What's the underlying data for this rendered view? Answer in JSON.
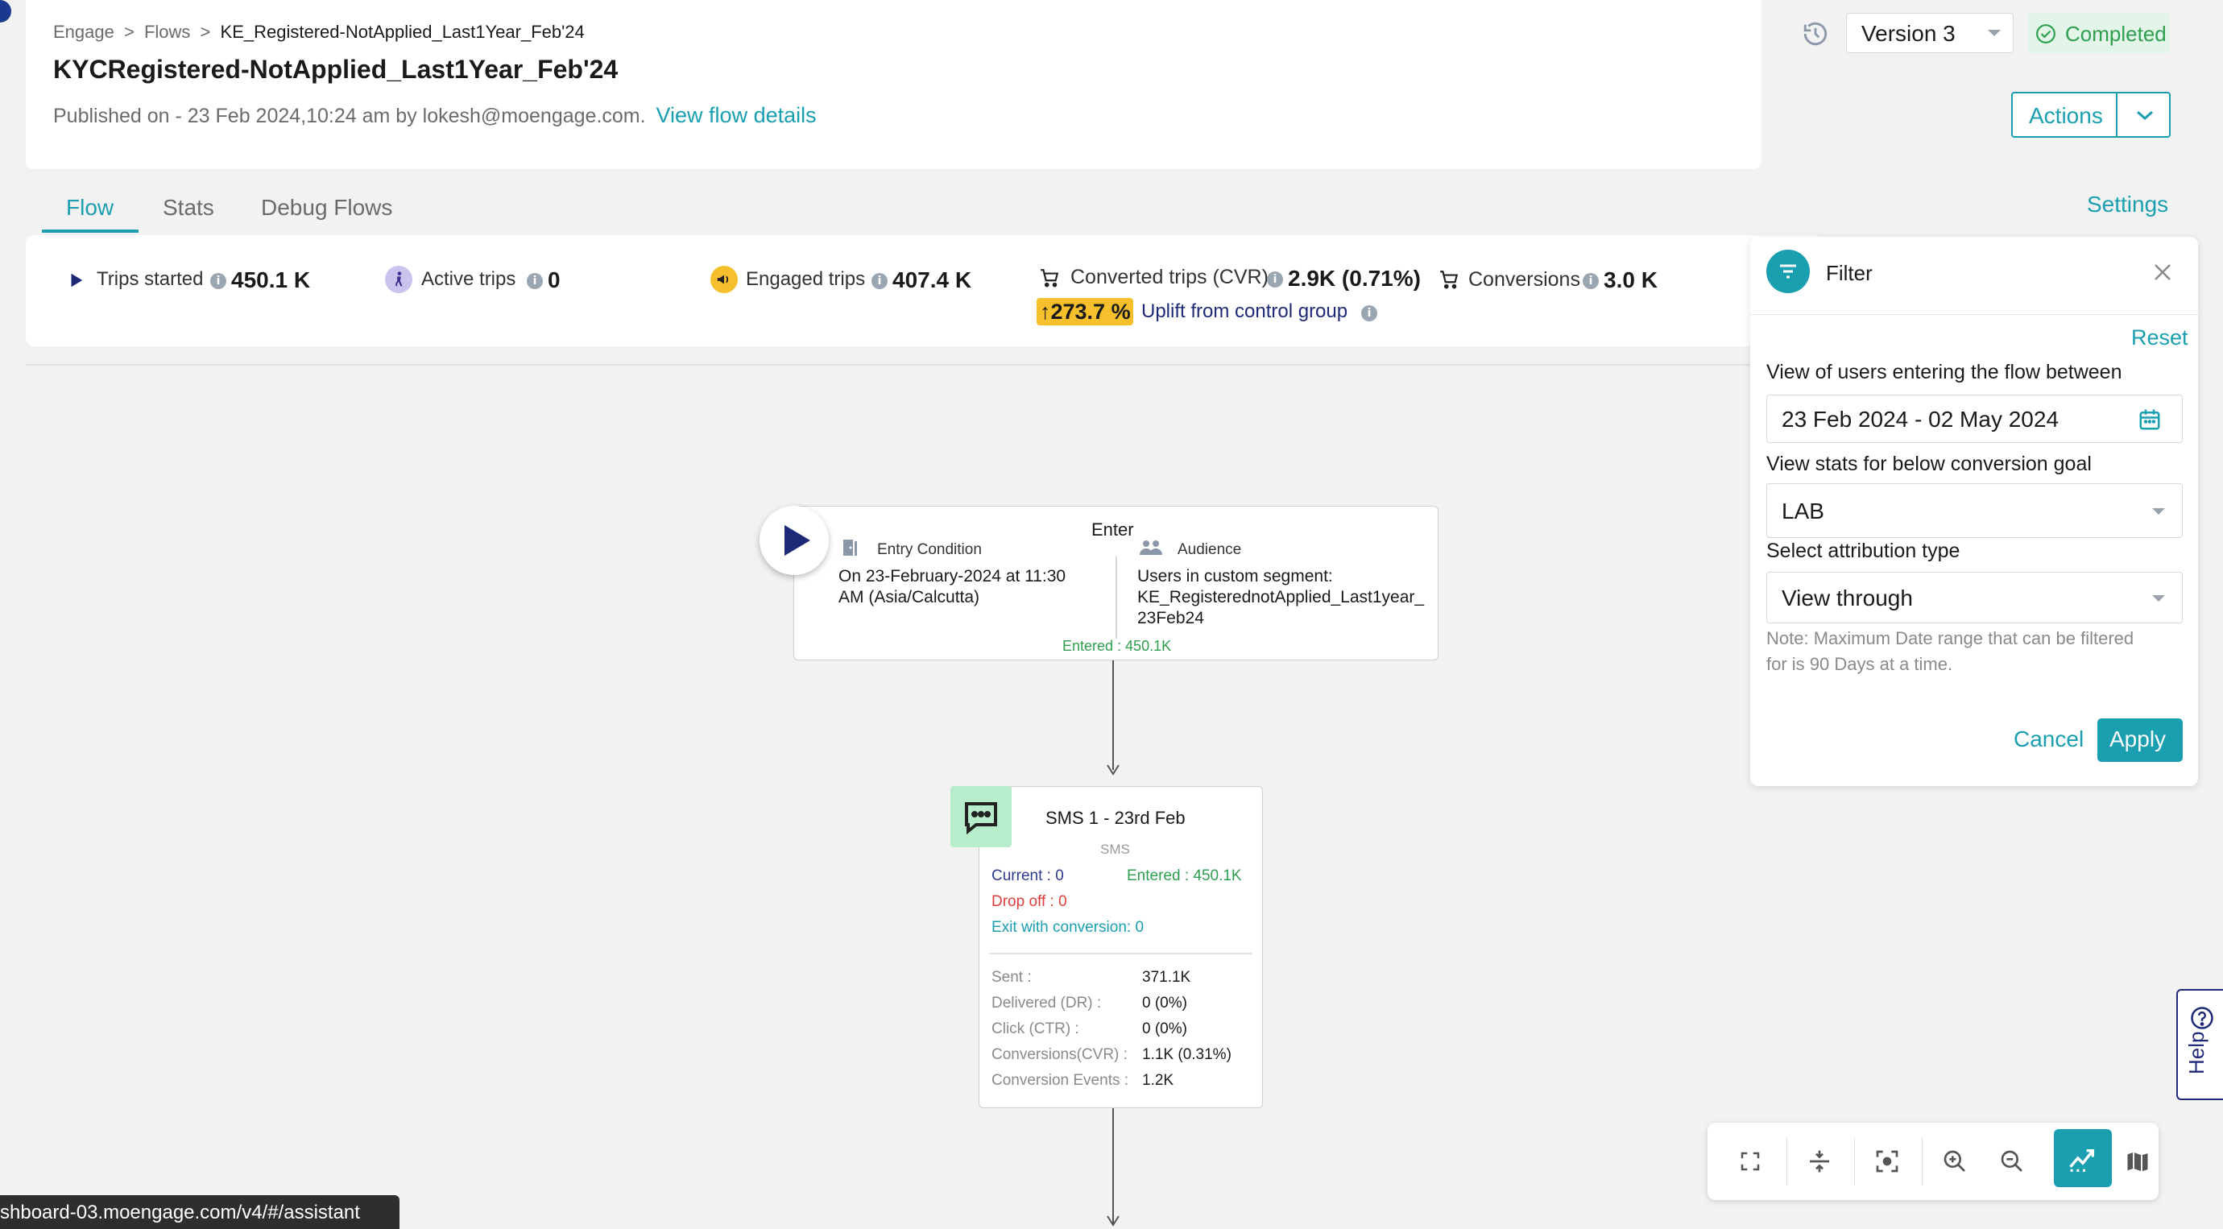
{
  "header": {
    "breadcrumb": [
      "Engage",
      "Flows",
      "KE_Registered-NotApplied_Last1Year_Feb'24"
    ],
    "breadcrumb_sep": ">",
    "title": "KYCRegistered-NotApplied_Last1Year_Feb'24",
    "published": "Published on - 23 Feb 2024,10:24 am by lokesh@moengage.com.",
    "view_details_link": "View flow details",
    "version": "Version 3",
    "status": "Completed",
    "actions_label": "Actions"
  },
  "tabs": [
    {
      "label": "Flow",
      "active": true
    },
    {
      "label": "Stats",
      "active": false
    },
    {
      "label": "Debug Flows",
      "active": false
    }
  ],
  "settings_link": "Settings",
  "stats": {
    "trips_started": {
      "label": "Trips started",
      "value": "450.1 K"
    },
    "active_trips": {
      "label": "Active trips",
      "value": "0"
    },
    "engaged_trips": {
      "label": "Engaged trips",
      "value": "407.4 K"
    },
    "converted_trips": {
      "label": "Converted trips (CVR)",
      "value": "2.9K (0.71%)"
    },
    "uplift_value": "↑273.7 %",
    "uplift_label": "Uplift from control group",
    "conversions": {
      "label": "Conversions",
      "value": "3.0 K"
    }
  },
  "enter_node": {
    "title": "Enter",
    "entry_condition_label": "Entry Condition",
    "entry_condition_text": [
      "On 23-February-2024 at 11:30",
      "AM (Asia/Calcutta)"
    ],
    "audience_label": "Audience",
    "audience_text": [
      "Users in custom segment:",
      "KE_RegisterednotApplied_Last1year_",
      "23Feb24"
    ],
    "entered": "Entered : 450.1K"
  },
  "sms_node": {
    "title": "SMS 1 - 23rd Feb",
    "subtitle": "SMS",
    "current": "Current : 0",
    "entered": "Entered : 450.1K",
    "drop_off": "Drop off : 0",
    "exit_with_conversion": "Exit with conversion: 0",
    "metrics": [
      {
        "label": "Sent :",
        "value": "371.1K"
      },
      {
        "label": "Delivered (DR) :",
        "value": "0 (0%)"
      },
      {
        "label": "Click (CTR) :",
        "value": "0 (0%)"
      },
      {
        "label": "Conversions(CVR) :",
        "value": "1.1K (0.31%)"
      },
      {
        "label": "Conversion Events :",
        "value": "1.2K"
      }
    ]
  },
  "filter": {
    "title": "Filter",
    "reset": "Reset",
    "date_label": "View of users entering the flow between",
    "date_value": "23 Feb 2024 - 02 May 2024",
    "goal_label": "View stats for below conversion goal",
    "goal_value": "LAB",
    "attribution_label": "Select attribution type",
    "attribution_value": "View through",
    "note": [
      "Note: Maximum Date range that can be filtered",
      "for is 90 Days at a time."
    ],
    "cancel": "Cancel",
    "apply": "Apply"
  },
  "help_label": "Help",
  "status_url": "shboard-03.moengage.com/v4/#/assistant",
  "colors": {
    "accent": "#1a9fb0",
    "success": "#2e9e4f",
    "danger": "#e03c3c",
    "current": "#2f3a8f",
    "uplift_bg": "#f6c02c"
  },
  "icons": [
    "history-icon",
    "chevron-down-icon",
    "check-circle-icon",
    "play-icon",
    "walker-icon",
    "megaphone-icon",
    "cart-icon",
    "info-icon",
    "door-icon",
    "people-icon",
    "message-icon",
    "filter-icon",
    "close-icon",
    "calendar-icon",
    "help-icon",
    "fullscreen-icon",
    "fit-vertical-icon",
    "focus-icon",
    "zoom-in-icon",
    "zoom-out-icon",
    "chart-icon",
    "map-icon"
  ]
}
